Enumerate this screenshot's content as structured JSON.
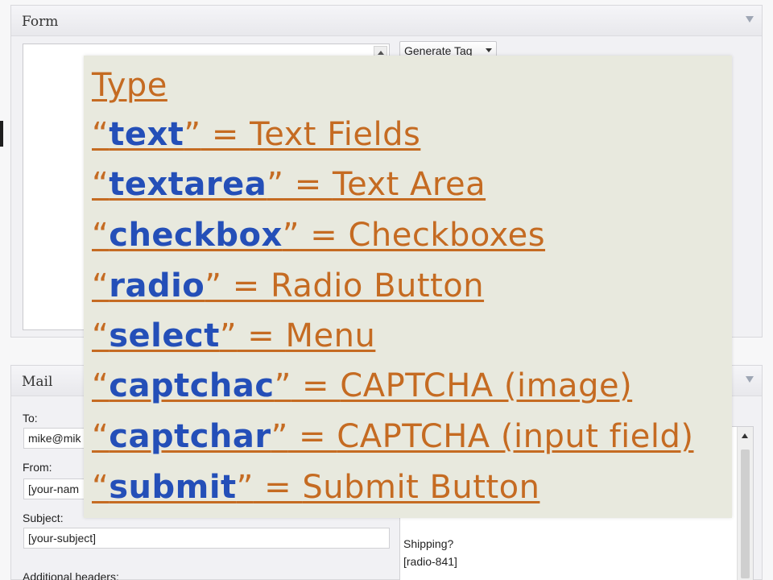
{
  "form": {
    "title": "Form",
    "generate_tag_label": "Generate Tag"
  },
  "mail": {
    "title": "Mail",
    "fields": [
      {
        "label": "To:",
        "value": "mike@mik"
      },
      {
        "label": "From:",
        "value": "[your-nam"
      },
      {
        "label": "Subject:",
        "value": "[your-subject]"
      }
    ],
    "additional_headers_label": "Additional headers:",
    "body_lines": [
      "Shipping?",
      "[radio-841]"
    ]
  },
  "overlay": {
    "heading": "Type",
    "open_quote": "“",
    "close_quote": "”",
    "equals": " = ",
    "items": [
      {
        "keyword": "text",
        "description": "Text Fields"
      },
      {
        "keyword": "textarea",
        "description": "Text Area"
      },
      {
        "keyword": "checkbox",
        "description": "Checkboxes"
      },
      {
        "keyword": "radio",
        "description": "Radio Button"
      },
      {
        "keyword": "select",
        "description": "Menu"
      },
      {
        "keyword": "captchac",
        "description": "CAPTCHA (image)"
      },
      {
        "keyword": "captchar",
        "description": "CAPTCHA (input field)"
      },
      {
        "keyword": "submit",
        "description": "Submit Button"
      }
    ]
  },
  "colors": {
    "keyword": "#244fb8",
    "text": "#c56b22",
    "overlay_background": "#e8e9de"
  },
  "icons": {
    "collapse": "triangle-down-icon",
    "dropdown": "caret-down-icon",
    "scroll": "arrow-up-icon"
  }
}
